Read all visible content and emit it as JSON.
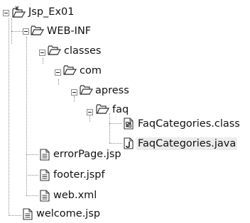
{
  "tree": {
    "root": "Jsp_Ex01",
    "web_inf": "WEB-INF",
    "classes": "classes",
    "com": "com",
    "apress": "apress",
    "faq": "faq",
    "faq_class": "FaqCategories.class",
    "faq_java": "FaqCategories.java",
    "error_page": "errorPage.jsp",
    "footer": "footer.jspf",
    "web_xml": "web.xml",
    "welcome": "welcome.jsp"
  },
  "selected_item": "FaqCategories.java",
  "icons": {
    "project": "project-folder-icon",
    "folder_open": "folder-open-icon",
    "class_file": "class-file-icon",
    "java_file": "java-file-icon",
    "document": "document-icon"
  }
}
